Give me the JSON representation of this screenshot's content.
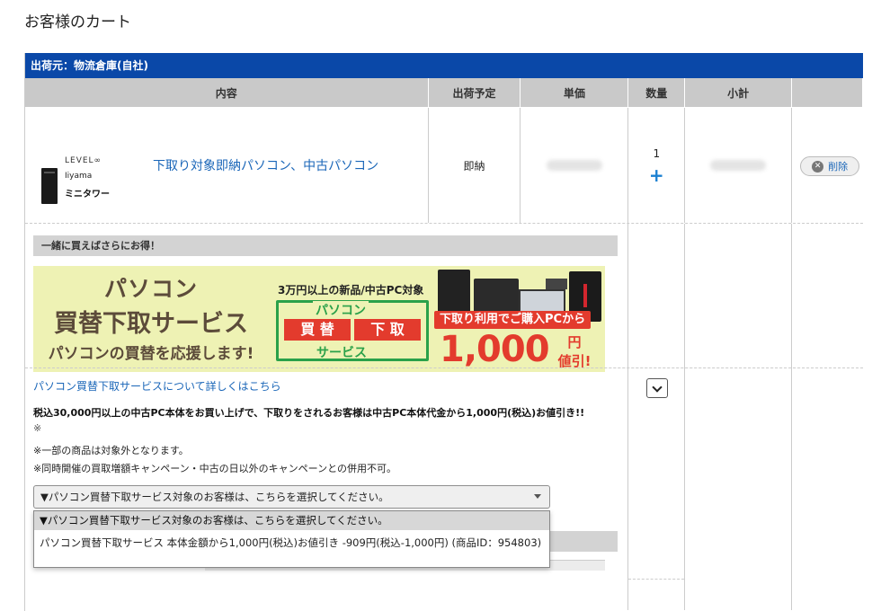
{
  "page": {
    "title": "お客様のカート"
  },
  "shipping": {
    "origin": "出荷元：物流倉庫(自社)"
  },
  "columns": {
    "content": "内容",
    "ship_date": "出荷予定",
    "unit_price": "単価",
    "quantity": "数量",
    "subtotal": "小計"
  },
  "item": {
    "brand": "LEVEL∞",
    "maker": "Iiyama",
    "model": "ミニタワー",
    "name": "下取り対象即納パソコン、中古パソコン",
    "ship": "即納",
    "quantity": "1",
    "plus": "+",
    "delete": "削除"
  },
  "bundle": {
    "title": "一緒に買えばさらにお得！",
    "banner": {
      "l1": "パソコン",
      "l2": "買替下取サービス",
      "l3": "パソコンの買替を応援します!",
      "caption": "3万円以上の新品/中古PC対象",
      "pc": "パソコン",
      "buy": "買 替",
      "trade": "下 取",
      "service": "サービス",
      "discount_caption": "下取り利用でご購入PCから",
      "amount": "1,000",
      "yen": "円",
      "off": "値引!"
    },
    "link": "パソコン買替下取サービスについて詳しくはこちら",
    "promo": "税込30,000円以上の中古PC本体をお買い上げで、下取りをされるお客様は中古PC本体代金から1,000円(税込)お値引き!!",
    "note_mark": "※",
    "note1": "※一部の商品は対象外となります。",
    "note2": "※同時開催の買取増額キャンペーン・中古の日以外のキャンペーンとの併用不可。",
    "select_value": "▼パソコン買替下取サービス対象のお客様は、こちらを選択してください。",
    "options": [
      "▼パソコン買替下取サービス対象のお客様は、こちらを選択してください。",
      "パソコン買替下取サービス 本体金額から1,000円(税込)お値引き -909円(税込-1,000円) (商品ID：954803)"
    ]
  },
  "colors": {
    "header_blue": "#0a48a8",
    "link_blue": "#1a66b8",
    "banner_red": "#e33b2d",
    "banner_green": "#2aa14a"
  }
}
